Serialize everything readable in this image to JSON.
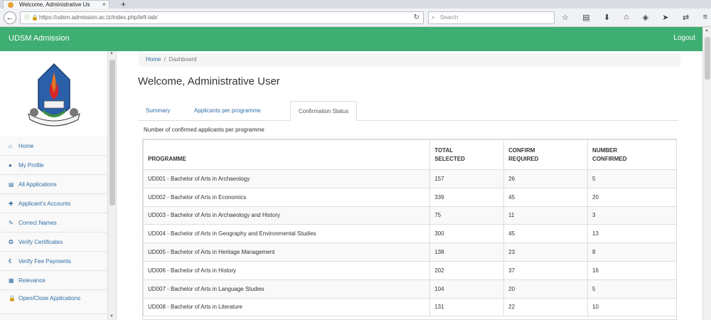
{
  "browser": {
    "tab_title": "Welcome, Administrative Us",
    "url": "https://udsm.admission.ac.tz/index.php/left-tab/",
    "search_placeholder": "Search"
  },
  "app": {
    "brand": "UDSM Admission",
    "logout_label": "Logout"
  },
  "sidebar": {
    "items": [
      {
        "label": "Home",
        "icon": "home-icon",
        "active": true
      },
      {
        "label": "My Profile",
        "icon": "user-icon"
      },
      {
        "label": "All Applications",
        "icon": "list-icon"
      },
      {
        "label": "Applicant's Accounts",
        "icon": "plus-icon"
      },
      {
        "label": "Correct Names",
        "icon": "pencil-icon"
      },
      {
        "label": "Verify Certificates",
        "icon": "badge-icon"
      },
      {
        "label": "Verify Fee Payments",
        "icon": "dollar-icon"
      },
      {
        "label": "Relevance",
        "icon": "building-icon"
      },
      {
        "label": "Open/Close Applications",
        "icon": "lock-icon"
      }
    ]
  },
  "breadcrumb": {
    "home": "Home",
    "separator": "/",
    "current": "Dashboard"
  },
  "page": {
    "title": "Welcome, Administrative User",
    "tabs": [
      {
        "label": "Summary"
      },
      {
        "label": "Applicants per programme"
      },
      {
        "label": "Confirmation Status",
        "active": true
      }
    ],
    "subheading": "Number of confirmed applicants per programme"
  },
  "table": {
    "headers": [
      "PROGRAMME",
      "TOTAL SELECTED",
      "CONFIRM REQUIRED",
      "NUMBER CONFIRMED"
    ],
    "rows": [
      [
        "UD001 - Bachelor of Arts in Archaeology",
        "157",
        "26",
        "5"
      ],
      [
        "UD002 - Bachelor of Arts in Economics",
        "339",
        "45",
        "20"
      ],
      [
        "UD003 - Bachelor of Arts in Archaeology and History",
        "75",
        "11",
        "3"
      ],
      [
        "UD004 - Bachelor of Arts in Geography and Environmental Studies",
        "300",
        "45",
        "13"
      ],
      [
        "UD005 - Bachelor of Arts in Heritage Management",
        "138",
        "23",
        "8"
      ],
      [
        "UD006 - Bachelor of Arts in History",
        "202",
        "37",
        "16"
      ],
      [
        "UD007 - Bachelor of Arts in Language Studies",
        "104",
        "20",
        "5"
      ],
      [
        "UD008 - Bachelor of Arts in Literature",
        "131",
        "22",
        "10"
      ]
    ]
  },
  "colors": {
    "header_green": "#3fae72",
    "active_blue": "#2f7bc2",
    "link_blue": "#2e6da4"
  }
}
